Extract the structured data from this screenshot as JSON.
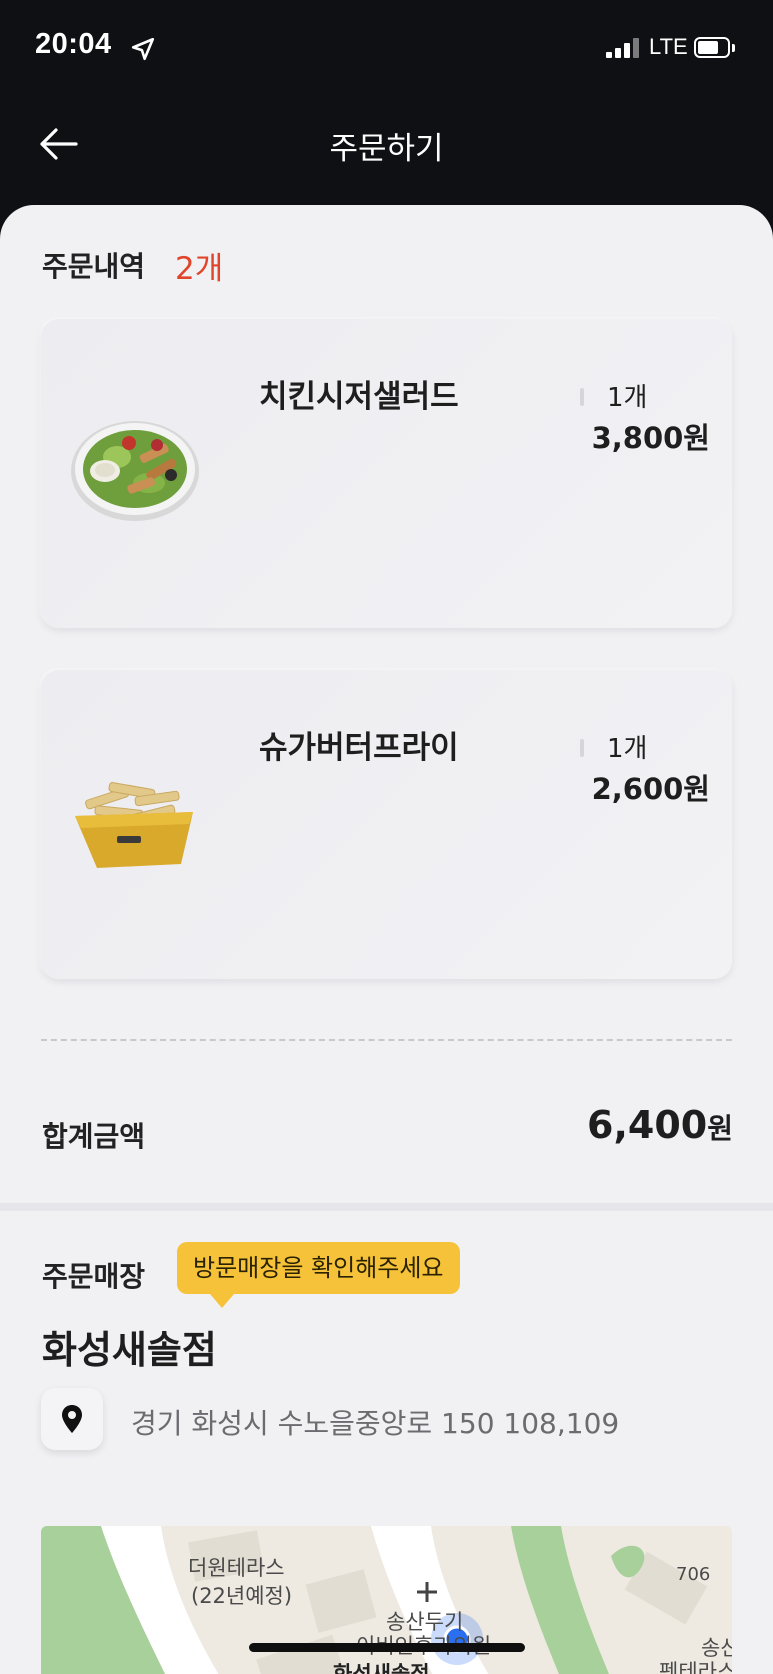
{
  "status_bar": {
    "time": "20:04",
    "network": "LTE"
  },
  "header": {
    "title": "주문하기"
  },
  "order": {
    "section_label": "주문내역",
    "count_label": "2개",
    "items": [
      {
        "name": "치킨시저샐러드",
        "qty": "1개",
        "price": "3,800원",
        "image": "chicken-caesar-salad"
      },
      {
        "name": "슈가버터프라이",
        "qty": "1개",
        "price": "2,600원",
        "image": "sugar-butter-fries"
      }
    ],
    "total_label": "합계금액",
    "total_value": "6,400",
    "total_unit": "원"
  },
  "store": {
    "section_label": "주문매장",
    "tooltip": "방문매장을 확인해주세요",
    "name": "화성새솔점",
    "address": "경기 화성시 수노을중앙로 150 108,109"
  },
  "map": {
    "labels": [
      "더원테라스",
      "(22년예정)",
      "송산두기",
      "이비인후과의원",
      "706",
      "송산",
      "펜테라스",
      "화성새솔점"
    ]
  },
  "colors": {
    "accent": "#e0452b",
    "tooltip": "#f5c23a",
    "map_green": "#a8d09a",
    "location_blue": "#2a6ff0"
  }
}
